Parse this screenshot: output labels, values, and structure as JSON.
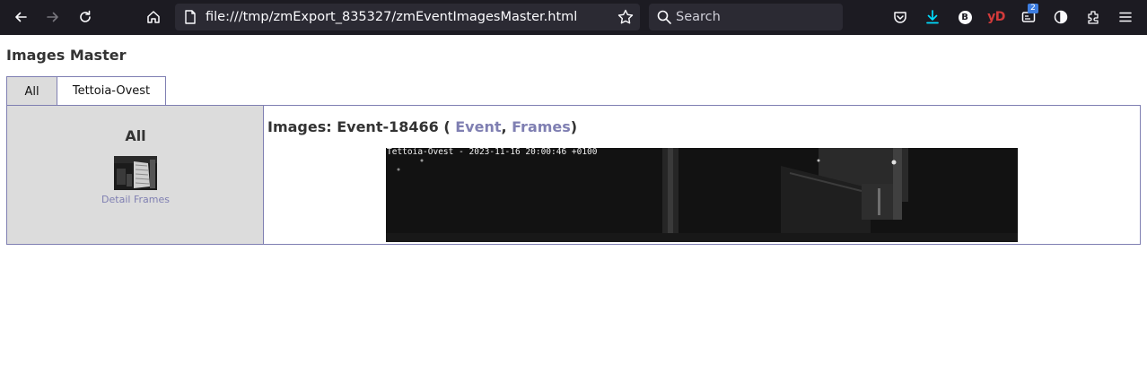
{
  "browser": {
    "url": "file:///tmp/zmExport_835327/zmEventImagesMaster.html",
    "search_placeholder": "Search",
    "extensions": {
      "b_label": "B",
      "yd_label": "yD",
      "container_badge": "2"
    },
    "icons": [
      "back-icon",
      "forward-icon",
      "reload-icon",
      "home-icon",
      "page-icon",
      "bookmark-star-icon",
      "search-icon",
      "pocket-icon",
      "download-icon",
      "extensions-icon",
      "menu-icon"
    ],
    "colors": {
      "toolbar": "#1c1b22",
      "field": "#2b2a33",
      "download_accent": "#00ddff"
    }
  },
  "page": {
    "title": "Images Master",
    "tabs": [
      {
        "label": "All",
        "active": true
      },
      {
        "label": "Tettoia-Ovest",
        "active": false
      }
    ],
    "sidebar": {
      "title": "All",
      "link_label": "Detail Frames"
    },
    "main": {
      "heading_prefix": "Images: Event-18466 ( ",
      "event_link": "Event",
      "separator": ", ",
      "frames_link": "Frames",
      "heading_suffix": ")",
      "image_overlay": "Tettoia-Ovest - 2023-11-16 20:00:46 +0100"
    },
    "colors": {
      "link": "#7f7fb2",
      "border": "#7f7fb2",
      "sidebar_bg": "#dcdcdc",
      "text": "#333333"
    }
  }
}
